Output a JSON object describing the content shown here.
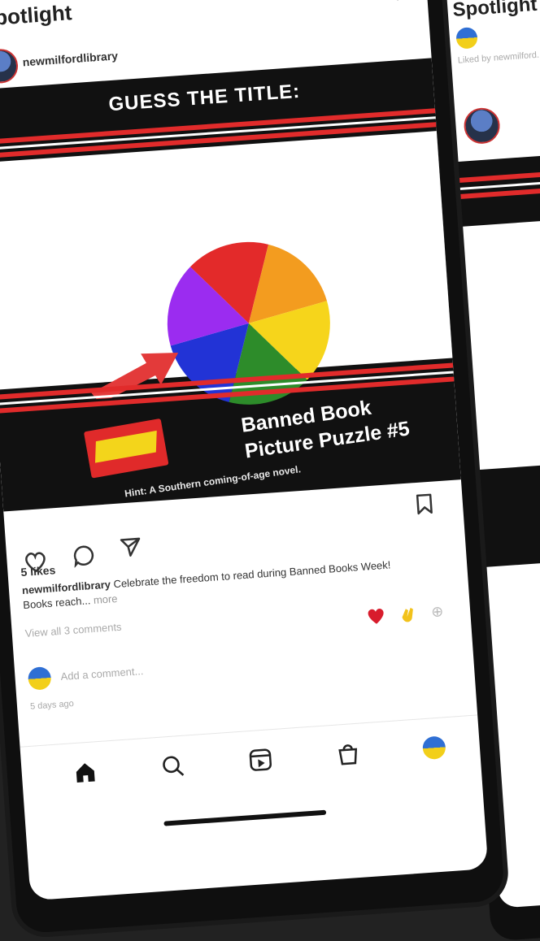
{
  "header": {
    "title": "Spotlight",
    "more_icon": "more-dots-icon"
  },
  "post": {
    "username": "newmilfordlibrary",
    "image": {
      "banner": "GUESS THE TITLE:",
      "title_line1": "Banned Book",
      "title_line2": "Picture Puzzle #5",
      "caption": "Hint: A Southern coming-of-age novel.",
      "wheel_colors": [
        "#e32a2a",
        "#f39c1f",
        "#f6d51b",
        "#2d8c2a",
        "#2233d6",
        "#9b2cf0"
      ],
      "arrow_color": "#e33a3a",
      "stripe_color": "#e12b2b"
    },
    "likes": "5 likes",
    "caption_user": "newmilfordlibrary",
    "caption_text": "Celebrate the freedom to read during Banned Books Week! Books reach...",
    "more_label": "more",
    "view_comments": "View all 3 comments",
    "add_comment_placeholder": "Add a comment...",
    "time_ago": "5 days ago"
  },
  "icons": {
    "like": "heart-outline-icon",
    "comment": "comment-bubble-icon",
    "share": "send-icon",
    "save": "bookmark-icon",
    "quick_heart": "red-heart-icon",
    "quick_clap": "clapping-hands-icon",
    "quick_more": "add-reaction-icon"
  },
  "nav": {
    "items": [
      "home",
      "search",
      "reels",
      "shop",
      "profile"
    ]
  },
  "second_screen": {
    "title": "Spotlight",
    "sub": "Liked by newmilford..."
  }
}
